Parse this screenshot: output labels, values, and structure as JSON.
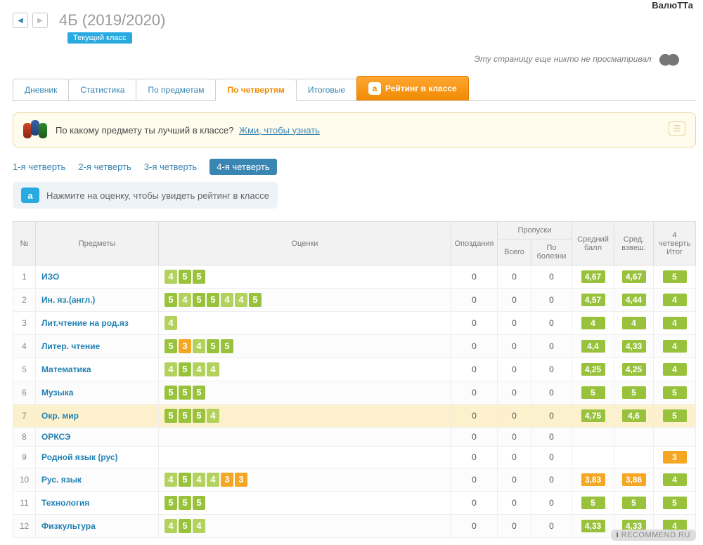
{
  "user": "ВалюТТа",
  "nav": {
    "class_title": "4Б (2019/2020)",
    "current_badge": "Текущий класс"
  },
  "notice": "Эту страницу еще никто не просматривал",
  "tabs": {
    "diary": "Дневник",
    "stats": "Статистика",
    "by_subject": "По предметам",
    "by_quarter": "По четвертям",
    "final": "Итоговые",
    "rating_icon": "a",
    "rating": "Рейтинг в классе"
  },
  "prompt": {
    "text": "По какому предмету ты лучший в классе?",
    "link": "Жми, чтобы узнать"
  },
  "quarters": {
    "q1": "1-я четверть",
    "q2": "2-я четверть",
    "q3": "3-я четверть",
    "q4": "4-я четверть"
  },
  "hint": {
    "icon": "a",
    "text": "Нажмите на оценку, чтобы увидеть рейтинг в классе"
  },
  "headers": {
    "num": "№",
    "subject": "Предметы",
    "marks": "Оценки",
    "late": "Опоздания",
    "absences": "Пропуски",
    "abs_total": "Всего",
    "abs_sick": "По болезни",
    "avg": "Средний балл",
    "wavg": "Сред. взвеш.",
    "final": "4 четверть Итог"
  },
  "rows": [
    {
      "n": "1",
      "subj": "ИЗО",
      "marks": [
        "4",
        "5",
        "5"
      ],
      "late": "0",
      "tot": "0",
      "sick": "0",
      "avg": "4,67",
      "wavg": "4,67",
      "fin": "5",
      "avg_c": "good",
      "wavg_c": "good",
      "fin_c": "good",
      "hl": false
    },
    {
      "n": "2",
      "subj": "Ин. яз.(англ.)",
      "marks": [
        "5",
        "4",
        "5",
        "5",
        "4",
        "4",
        "5"
      ],
      "late": "0",
      "tot": "0",
      "sick": "0",
      "avg": "4,57",
      "wavg": "4,44",
      "fin": "4",
      "avg_c": "good",
      "wavg_c": "good",
      "fin_c": "good",
      "hl": false
    },
    {
      "n": "3",
      "subj": "Лит.чтение на род.яз",
      "marks": [
        "4"
      ],
      "late": "0",
      "tot": "0",
      "sick": "0",
      "avg": "4",
      "wavg": "4",
      "fin": "4",
      "avg_c": "good",
      "wavg_c": "good",
      "fin_c": "good",
      "hl": false
    },
    {
      "n": "4",
      "subj": "Литер. чтение",
      "marks": [
        "5",
        "3",
        "4",
        "5",
        "5"
      ],
      "late": "0",
      "tot": "0",
      "sick": "0",
      "avg": "4,4",
      "wavg": "4,33",
      "fin": "4",
      "avg_c": "good",
      "wavg_c": "good",
      "fin_c": "good",
      "hl": false
    },
    {
      "n": "5",
      "subj": "Математика",
      "marks": [
        "4",
        "5",
        "4",
        "4"
      ],
      "late": "0",
      "tot": "0",
      "sick": "0",
      "avg": "4,25",
      "wavg": "4,25",
      "fin": "4",
      "avg_c": "good",
      "wavg_c": "good",
      "fin_c": "good",
      "hl": false
    },
    {
      "n": "6",
      "subj": "Музыка",
      "marks": [
        "5",
        "5",
        "5"
      ],
      "late": "0",
      "tot": "0",
      "sick": "0",
      "avg": "5",
      "wavg": "5",
      "fin": "5",
      "avg_c": "good",
      "wavg_c": "good",
      "fin_c": "good",
      "hl": false
    },
    {
      "n": "7",
      "subj": "Окр. мир",
      "marks": [
        "5",
        "5",
        "5",
        "4"
      ],
      "late": "0",
      "tot": "0",
      "sick": "0",
      "avg": "4,75",
      "wavg": "4,6",
      "fin": "5",
      "avg_c": "good",
      "wavg_c": "good",
      "fin_c": "good",
      "hl": true
    },
    {
      "n": "8",
      "subj": "ОРКСЭ",
      "marks": [],
      "late": "0",
      "tot": "0",
      "sick": "0",
      "avg": "",
      "wavg": "",
      "fin": "",
      "avg_c": "",
      "wavg_c": "",
      "fin_c": "",
      "hl": false
    },
    {
      "n": "9",
      "subj": "Родной язык (рус)",
      "marks": [],
      "late": "0",
      "tot": "0",
      "sick": "0",
      "avg": "",
      "wavg": "",
      "fin": "3",
      "avg_c": "",
      "wavg_c": "",
      "fin_c": "warn",
      "hl": false
    },
    {
      "n": "10",
      "subj": "Рус. язык",
      "marks": [
        "4",
        "5",
        "4",
        "4",
        "3",
        "3"
      ],
      "late": "0",
      "tot": "0",
      "sick": "0",
      "avg": "3,83",
      "wavg": "3,86",
      "fin": "4",
      "avg_c": "warn",
      "wavg_c": "warn",
      "fin_c": "good",
      "hl": false
    },
    {
      "n": "11",
      "subj": "Технология",
      "marks": [
        "5",
        "5",
        "5"
      ],
      "late": "0",
      "tot": "0",
      "sick": "0",
      "avg": "5",
      "wavg": "5",
      "fin": "5",
      "avg_c": "good",
      "wavg_c": "good",
      "fin_c": "good",
      "hl": false
    },
    {
      "n": "12",
      "subj": "Физкультура",
      "marks": [
        "4",
        "5",
        "4"
      ],
      "late": "0",
      "tot": "0",
      "sick": "0",
      "avg": "4,33",
      "wavg": "4,33",
      "fin": "4",
      "avg_c": "good",
      "wavg_c": "good",
      "fin_c": "good",
      "hl": false
    }
  ],
  "watermark": {
    "site": "RECOMMEND",
    "tld": ".RU"
  }
}
